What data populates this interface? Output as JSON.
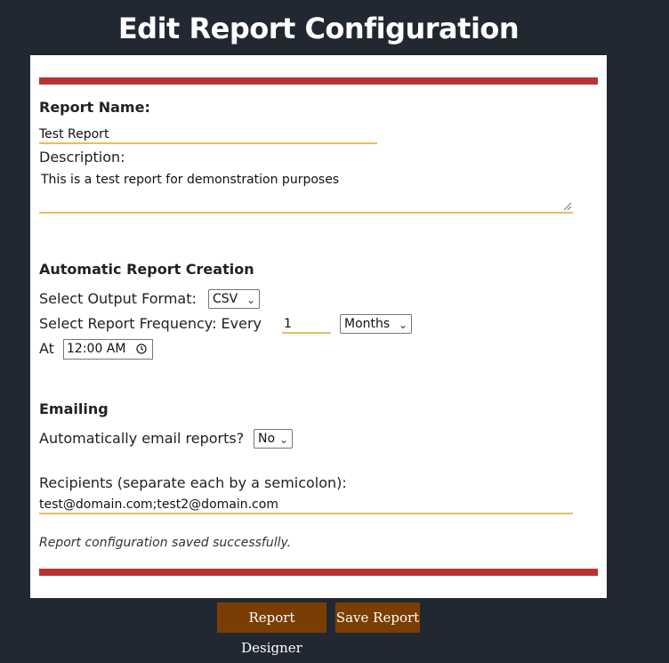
{
  "header": {
    "title": "Edit Report Configuration"
  },
  "form": {
    "report_name_label": "Report Name:",
    "report_name_value": "Test Report",
    "description_label": "Description:",
    "description_value": "This is a test report for demonstration purposes",
    "auto_section_heading": "Automatic Report Creation",
    "output_format_label": "Select Output Format:",
    "output_format_value": "CSV",
    "frequency_label": "Select Report Frequency: Every",
    "frequency_value": "1",
    "frequency_unit_value": "Months",
    "at_label": "At",
    "time_value": "12:00 AM",
    "email_section_heading": "Emailing",
    "auto_email_label": "Automatically email reports?",
    "auto_email_value": "No",
    "recipients_label": "Recipients (separate each by a semicolon):",
    "recipients_value": "test@domain.com;test2@domain.com",
    "status_message": "Report configuration saved successfully."
  },
  "buttons": {
    "report_designer_label": "Report Designer",
    "save_report_label": "Save Report"
  },
  "icons": {
    "dropdown": "chevron-down-icon",
    "time": "clock-icon"
  },
  "colors": {
    "background": "#222831",
    "accent_bar": "#b83333",
    "input_underline": "#e4c060",
    "button": "#7a3e04"
  }
}
